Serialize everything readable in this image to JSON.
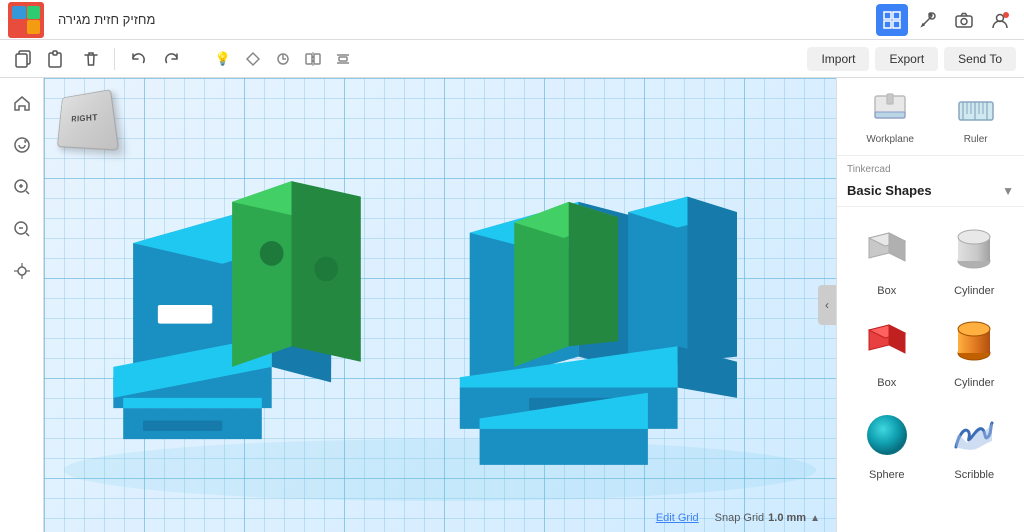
{
  "app": {
    "title": "מחזיק חזית מגירה",
    "logo_cells": [
      "tl",
      "tr",
      "bl",
      "br"
    ]
  },
  "topbar": {
    "brand": "TINKERCAD"
  },
  "toolbar": {
    "copy_label": "Copy",
    "paste_label": "Paste",
    "delete_label": "Delete",
    "undo_label": "Undo",
    "redo_label": "Redo",
    "import_label": "Import",
    "export_label": "Export",
    "send_to_label": "Send To"
  },
  "viewport": {
    "edit_grid_label": "Edit Grid",
    "snap_grid_label": "Snap Grid",
    "snap_grid_value": "1.0 mm",
    "cube_label": "RIGHT"
  },
  "right_panel": {
    "workplane_label": "Workplane",
    "ruler_label": "Ruler",
    "category_label": "Tinkercad",
    "shapes_group_label": "Basic Shapes",
    "shapes": [
      {
        "id": "box-gray",
        "label": "Box",
        "color": "gray"
      },
      {
        "id": "cylinder-gray",
        "label": "Cylinder",
        "color": "gray"
      },
      {
        "id": "box-red",
        "label": "Box",
        "color": "red"
      },
      {
        "id": "cylinder-orange",
        "label": "Cylinder",
        "color": "orange"
      },
      {
        "id": "sphere-teal",
        "label": "Sphere",
        "color": "teal"
      },
      {
        "id": "scribble",
        "label": "Scribble",
        "color": "blue"
      }
    ]
  }
}
